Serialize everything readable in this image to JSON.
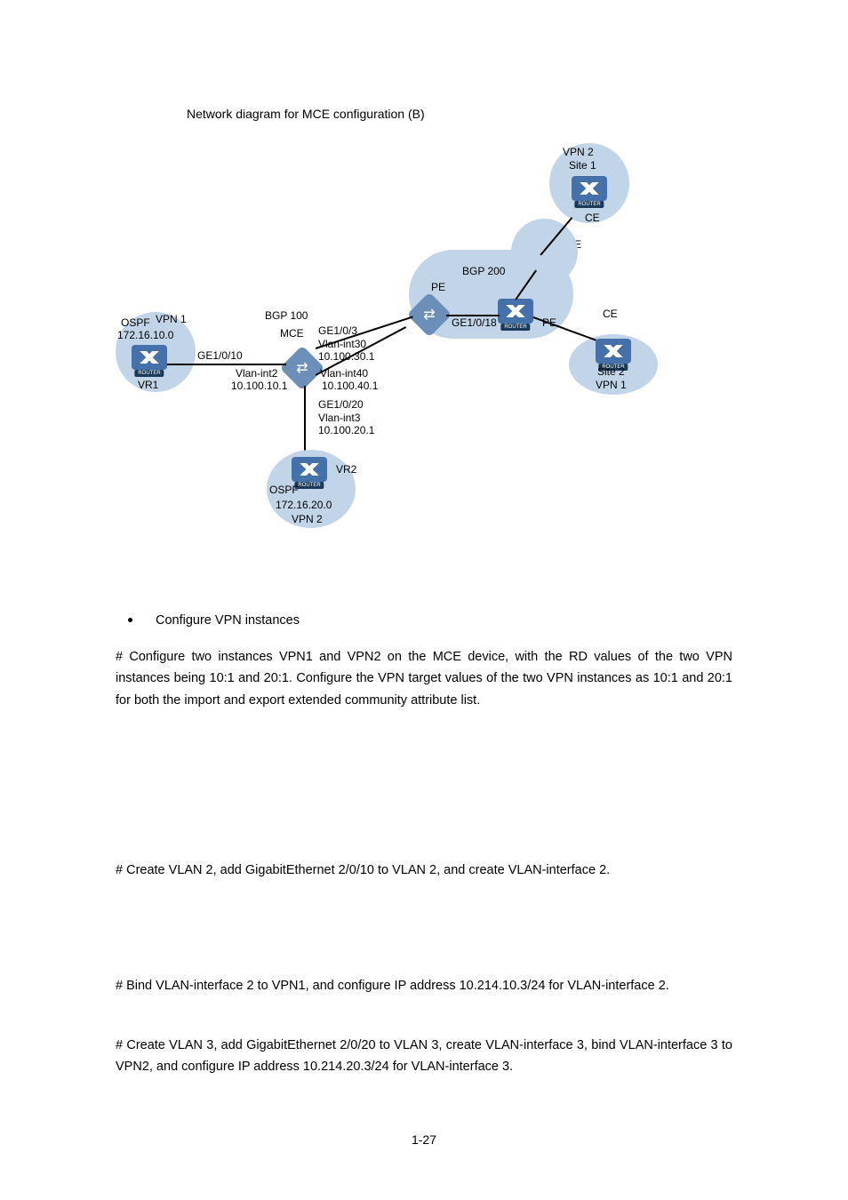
{
  "figure": {
    "caption": "Network diagram for MCE configuration (B)",
    "labels": {
      "vpn2_site1_vpn": "VPN 2",
      "vpn2_site1_site": "Site 1",
      "ce_top": "CE",
      "pe_right": "PE",
      "bgp200": "BGP 200",
      "pe_center": "PE",
      "pe_centerR": "PE",
      "ge1018": "GE1/0/18",
      "ce_right": "CE",
      "ospf_left": "OSPF",
      "vpn1_left": "VPN 1",
      "vpn1_subnet": "172.16.10.0",
      "bgp100": "BGP 100",
      "mce": "MCE",
      "ge103": "GE1/0/3",
      "vlanint30": "Vlan-int30",
      "ip30": "10.100.30.1",
      "ge1010": "GE1/0/10",
      "vlanint2": "Vlan-int2",
      "ip101": "10.100.10.1",
      "vlanint40": "Vlan-int40",
      "ip40": "10.100.40.1",
      "vr1": "VR1",
      "site2": "Site 2",
      "vpn1_right": "VPN 1",
      "ge1020": "GE1/0/20",
      "vlanint3": "Vlan-int3",
      "ip201": "10.100.20.1",
      "vr2": "VR2",
      "ospf_bot": "OSPF",
      "vpn2_subnet": "172.16.20.0",
      "vpn2_bot": "VPN 2"
    }
  },
  "body": {
    "bullet1": "Configure VPN instances",
    "p1": "# Configure two instances VPN1 and VPN2 on the MCE device, with the RD values of the two VPN instances being 10:1 and 20:1. Configure the VPN target values of the two VPN instances as 10:1 and 20:1 for both the import and export extended community attribute list.",
    "p2": "# Create VLAN 2, add GigabitEthernet 2/0/10 to VLAN 2, and create VLAN-interface 2.",
    "p3": "# Bind VLAN-interface 2 to VPN1, and configure IP address 10.214.10.3/24 for VLAN-interface 2.",
    "p4": "# Create VLAN 3, add GigabitEthernet 2/0/20 to VLAN 3, create VLAN-interface 3, bind VLAN-interface 3 to VPN2, and configure IP address 10.214.20.3/24 for VLAN-interface 3."
  },
  "pageNumber": "1-27"
}
